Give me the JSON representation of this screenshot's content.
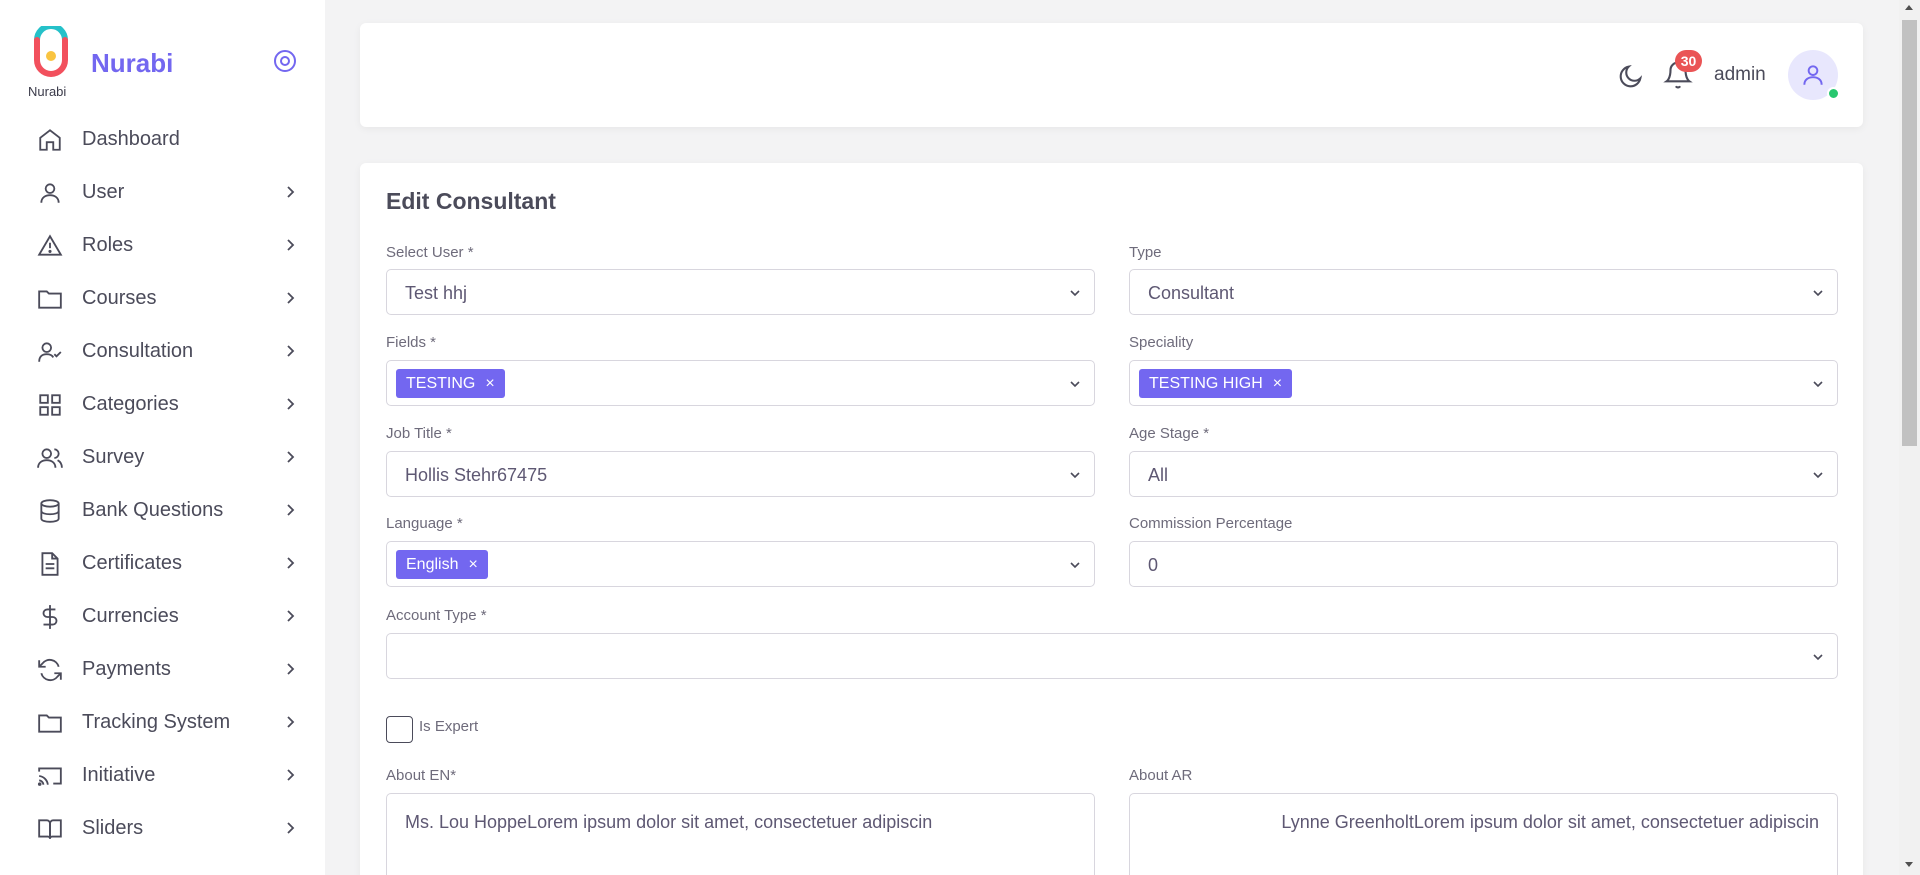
{
  "brand": {
    "name": "Nurabi",
    "caption": "Nurabi",
    "accent": "#7367f0"
  },
  "sidebar": {
    "items": [
      {
        "label": "Dashboard",
        "icon": "home-icon",
        "has_chevron": false
      },
      {
        "label": "User",
        "icon": "user-icon",
        "has_chevron": true
      },
      {
        "label": "Roles",
        "icon": "alert-triangle-icon",
        "has_chevron": true
      },
      {
        "label": "Courses",
        "icon": "folder-icon",
        "has_chevron": true
      },
      {
        "label": "Consultation",
        "icon": "user-check-icon",
        "has_chevron": true
      },
      {
        "label": "Categories",
        "icon": "grid-icon",
        "has_chevron": true
      },
      {
        "label": "Survey",
        "icon": "users-icon",
        "has_chevron": true
      },
      {
        "label": "Bank Questions",
        "icon": "database-icon",
        "has_chevron": true
      },
      {
        "label": "Certificates",
        "icon": "file-text-icon",
        "has_chevron": true
      },
      {
        "label": "Currencies",
        "icon": "dollar-icon",
        "has_chevron": true
      },
      {
        "label": "Payments",
        "icon": "refresh-icon",
        "has_chevron": true
      },
      {
        "label": "Tracking System",
        "icon": "folder-icon",
        "has_chevron": true
      },
      {
        "label": "Initiative",
        "icon": "cast-icon",
        "has_chevron": true
      },
      {
        "label": "Sliders",
        "icon": "book-open-icon",
        "has_chevron": true
      }
    ]
  },
  "navbar": {
    "user_name": "admin",
    "notification_count": "30"
  },
  "form": {
    "title": "Edit Consultant",
    "select_user": {
      "label": "Select User *",
      "value": "Test hhj"
    },
    "type": {
      "label": "Type",
      "value": "Consultant"
    },
    "fields": {
      "label": "Fields *",
      "chips": [
        "TESTING"
      ]
    },
    "speciality": {
      "label": "Speciality",
      "chips": [
        "TESTING HIGH"
      ]
    },
    "job_title": {
      "label": "Job Title *",
      "value": "Hollis Stehr67475"
    },
    "age_stage": {
      "label": "Age Stage *",
      "value": "All"
    },
    "language": {
      "label": "Language *",
      "chips": [
        "English"
      ]
    },
    "commission": {
      "label": "Commission Percentage",
      "value": "0"
    },
    "account_type": {
      "label": "Account Type *",
      "value": ""
    },
    "is_expert": {
      "label": "Is Expert",
      "checked": false
    },
    "about_en": {
      "label": "About EN*",
      "value": "Ms. Lou HoppeLorem ipsum dolor sit amet, consectetuer adipiscin"
    },
    "about_ar": {
      "label": "About AR",
      "value": "Lynne GreenholtLorem ipsum dolor sit amet, consectetuer adipiscin"
    }
  }
}
